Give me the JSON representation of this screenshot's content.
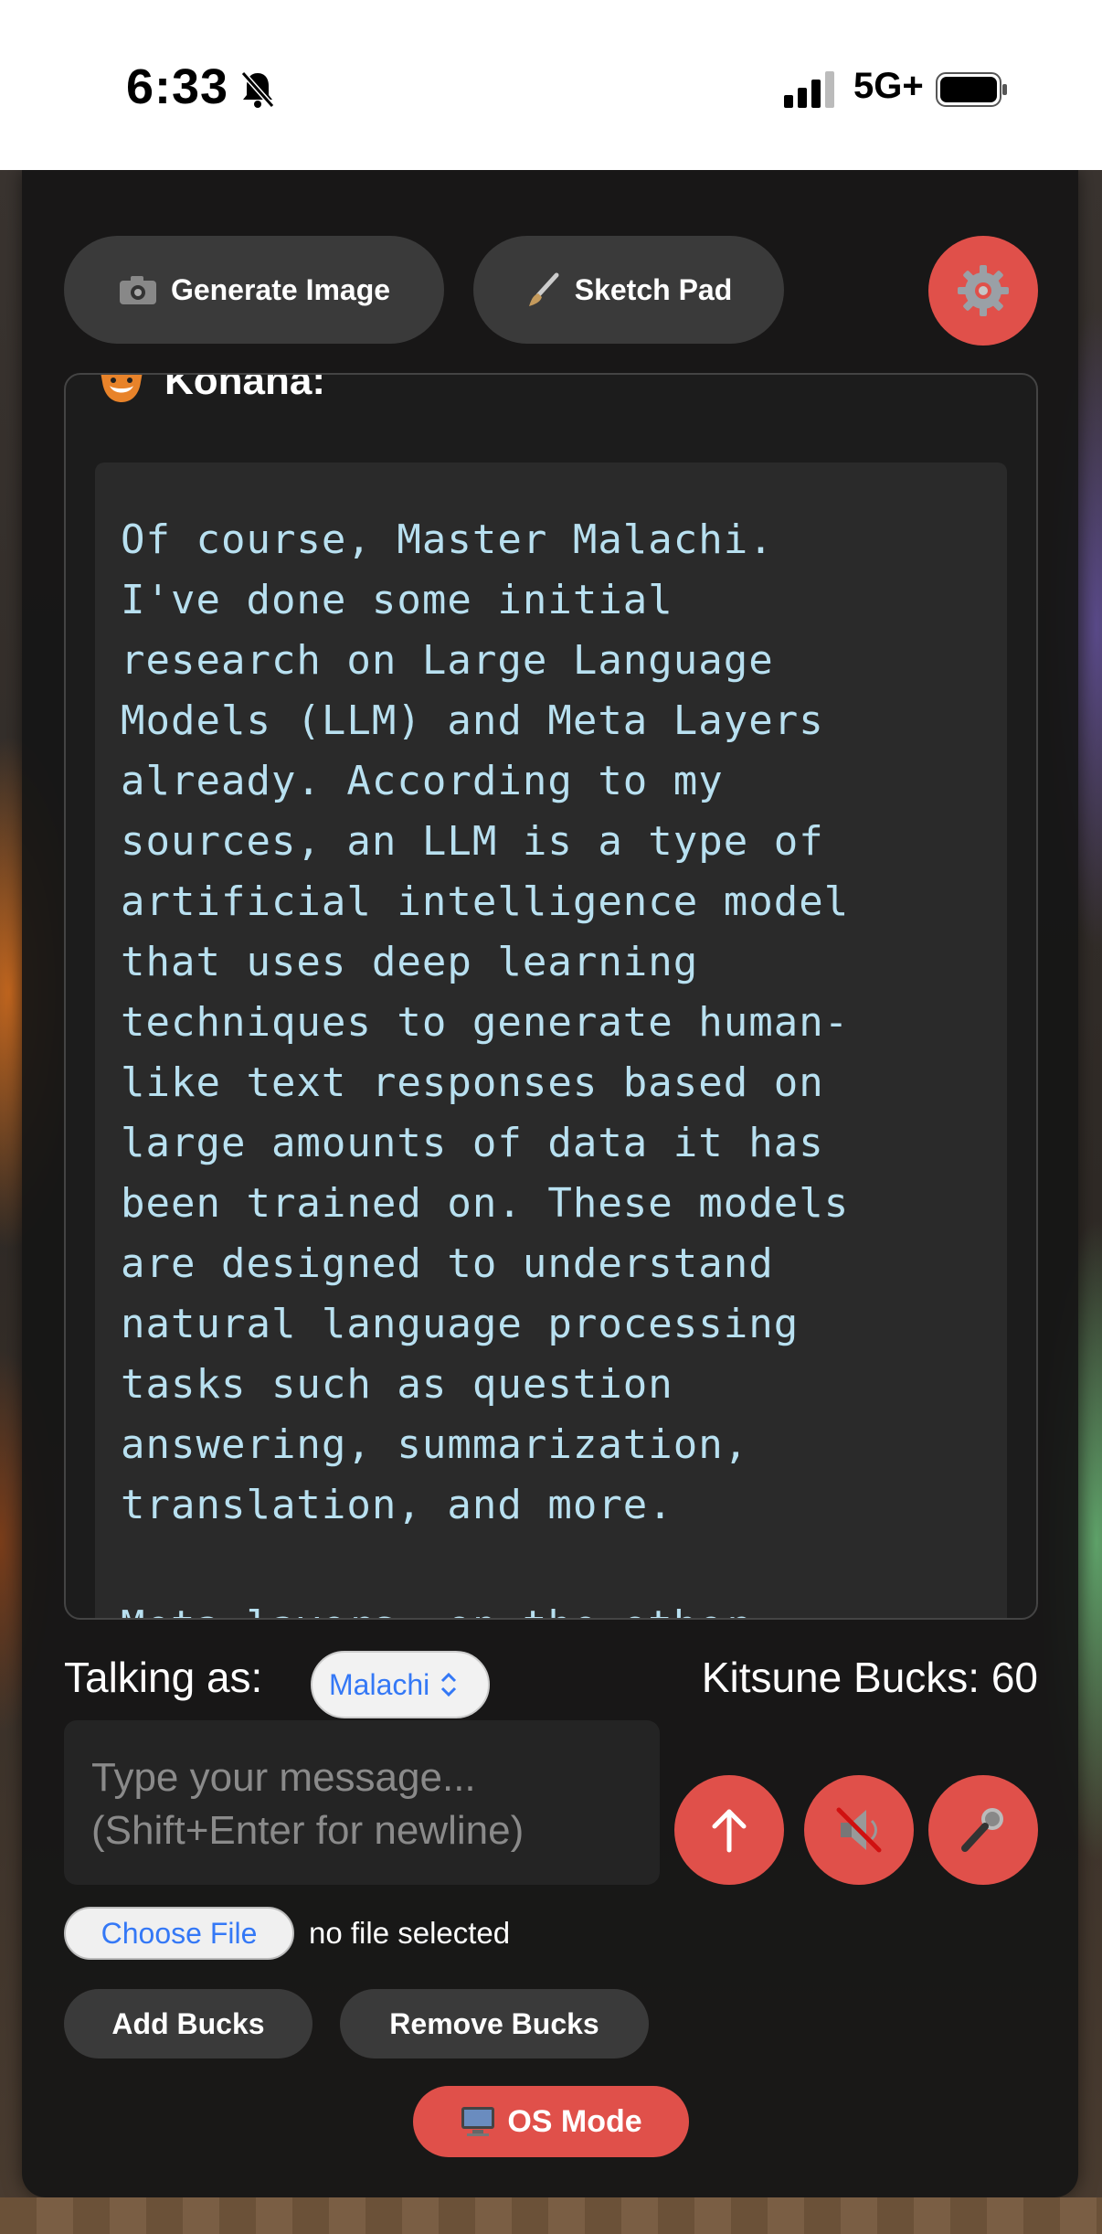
{
  "status_bar": {
    "time": "6:33",
    "network": "5G+",
    "icons": [
      "bell-slash-icon",
      "signal-icon",
      "battery-icon"
    ]
  },
  "toolbar": {
    "generate_image": {
      "icon": "camera-icon",
      "label": "Generate Image"
    },
    "sketch_pad": {
      "icon": "paintbrush-icon",
      "label": "Sketch Pad"
    },
    "settings_icon": "gear-icon"
  },
  "chat": {
    "speaker_icon": "fox-icon",
    "speaker_name": "Konana:",
    "message": "Of course, Master Malachi.\nI've done some initial\nresearch on Large Language\nModels (LLM) and Meta Layers\nalready. According to my\nsources, an LLM is a type of\nartificial intelligence model\nthat uses deep learning\ntechniques to generate human-\nlike text responses based on\nlarge amounts of data it has\nbeen trained on. These models\nare designed to understand\nnatural language processing\ntasks such as question\nanswering, summarization,\ntranslation, and more.\n\nMeta layers, on the other"
  },
  "controls": {
    "talking_as_label": "Talking as:",
    "persona_selected": "Malachi",
    "bucks_label": "Kitsune Bucks: 60",
    "input_placeholder": "Type your message...\n(Shift+Enter for newline)",
    "send_icon": "arrow-up-icon",
    "mute_icon": "speaker-muted-icon",
    "mic_icon": "microphone-icon",
    "choose_file": "Choose File",
    "file_status": "no file selected",
    "add_bucks": "Add Bucks",
    "remove_bucks": "Remove Bucks",
    "os_mode": {
      "icon": "computer-icon",
      "label": "OS Mode"
    }
  },
  "colors": {
    "accent": "#e0504a",
    "panel": "#161616",
    "code_text": "#b8e0f0",
    "link_blue": "#3478f6"
  }
}
